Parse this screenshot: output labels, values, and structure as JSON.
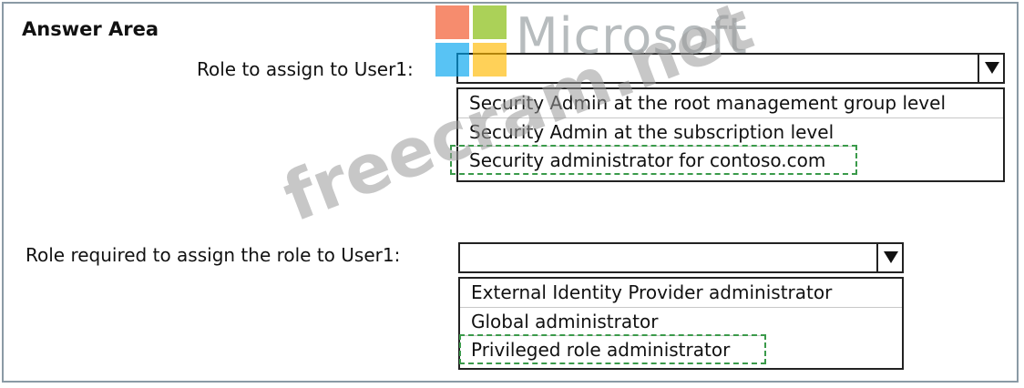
{
  "title": "Answer Area",
  "watermark": {
    "brand": "Microsoft",
    "logo_colors": [
      "#f25022",
      "#7fba00",
      "#00a4ef",
      "#ffb900"
    ],
    "text": "freecram.net"
  },
  "questions": [
    {
      "label": "Role to assign to User1:",
      "selected_value": "",
      "options": [
        "Security Admin at the root management group level",
        "Security Admin at the subscription level",
        "Security administrator for contoso.com"
      ],
      "correct_index": 2
    },
    {
      "label": "Role required to assign the role to User1:",
      "selected_value": "",
      "options": [
        "External Identity Provider administrator",
        "Global administrator",
        "Privileged role administrator"
      ],
      "correct_index": 2
    }
  ],
  "colors": {
    "answer_highlight": "#3a9a4a",
    "border": "#8a9aa5"
  }
}
